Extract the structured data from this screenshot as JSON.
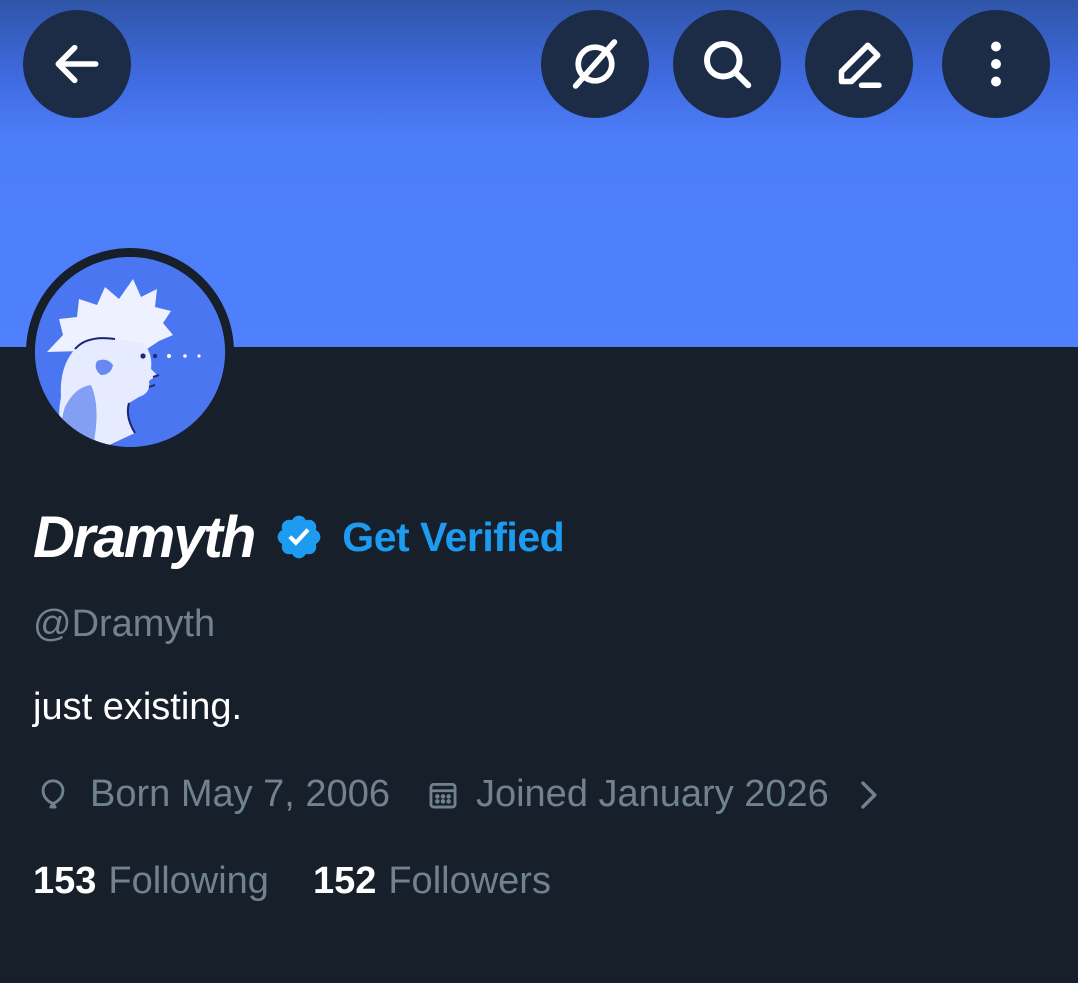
{
  "header": {
    "back_icon": "arrow-left-icon",
    "grok_icon": "grok-icon",
    "search_icon": "search-icon",
    "edit_icon": "edit-pencil-icon",
    "more_icon": "more-vertical-icon",
    "banner_color": "#4f80fd"
  },
  "profile": {
    "display_name": "Dramyth",
    "verified_icon": "verified-badge-icon",
    "get_verified_label": "Get Verified",
    "handle": "@Dramyth",
    "bio": "just existing.",
    "birth_icon": "balloon-icon",
    "born_text": "Born May 7, 2006",
    "joined_icon": "calendar-icon",
    "joined_text": "Joined January 2026",
    "chevron_icon": "chevron-right-icon",
    "following_count": "153",
    "following_label": "Following",
    "followers_count": "152",
    "followers_label": "Followers"
  },
  "colors": {
    "accent": "#1d9bf0",
    "background": "#17202a",
    "muted_text": "#71818f"
  }
}
